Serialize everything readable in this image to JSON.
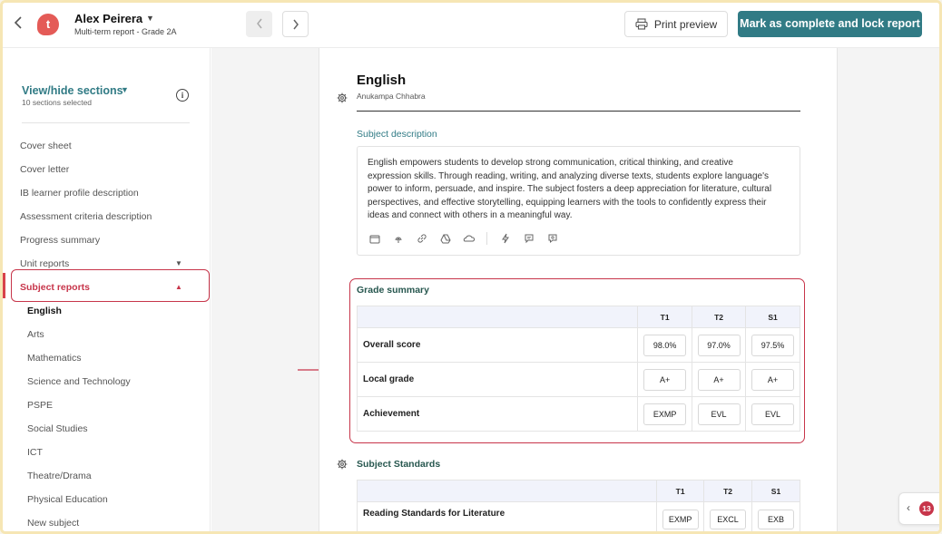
{
  "header": {
    "logo_letter": "t",
    "student_name": "Alex Peirera",
    "report_subtitle": "Multi-term report - Grade 2A",
    "print_label": "Print preview",
    "lock_label": "Mark as complete and lock report"
  },
  "sidebar": {
    "view_hide_label": "View/hide sections",
    "sections_selected": "10 sections selected",
    "items": [
      {
        "label": "Cover sheet"
      },
      {
        "label": "Cover letter"
      },
      {
        "label": "IB learner profile description"
      },
      {
        "label": "Assessment criteria description"
      },
      {
        "label": "Progress summary"
      },
      {
        "label": "Unit reports"
      }
    ],
    "active_item": "Subject reports",
    "subjects": [
      {
        "label": "English"
      },
      {
        "label": "Arts"
      },
      {
        "label": "Mathematics"
      },
      {
        "label": "Science and Technology"
      },
      {
        "label": "PSPE"
      },
      {
        "label": "Social Studies"
      },
      {
        "label": "ICT"
      },
      {
        "label": "Theatre/Drama"
      },
      {
        "label": "Physical Education"
      },
      {
        "label": "New subject"
      }
    ]
  },
  "main": {
    "subject_title": "English",
    "teacher": "Anukampa Chhabra",
    "description_heading": "Subject description",
    "description_lines": [
      "English empowers students to develop strong communication, critical thinking, and creative",
      "expression skills. Through reading, writing, and analyzing diverse texts, students explore language's",
      "power to inform, persuade, and inspire. The subject fosters a deep appreciation for literature, cultural",
      "perspectives, and effective storytelling, equipping learners with the tools to confidently express their",
      "ideas and connect with others in a meaningful way."
    ],
    "grade_summary": {
      "title": "Grade summary",
      "columns": [
        "T1",
        "T2",
        "S1"
      ],
      "rows": [
        {
          "label": "Overall score",
          "values": [
            "98.0%",
            "97.0%",
            "97.5%"
          ]
        },
        {
          "label": "Local grade",
          "values": [
            "A+",
            "A+",
            "A+"
          ]
        },
        {
          "label": "Achievement",
          "values": [
            "EXMP",
            "EVL",
            "EVL"
          ]
        }
      ]
    },
    "standards": {
      "title": "Subject Standards",
      "columns": [
        "T1",
        "T2",
        "S1"
      ],
      "rows": [
        {
          "label": "Reading Standards for Literature",
          "values": [
            "EXMP",
            "EXCL",
            "EXB"
          ]
        }
      ]
    }
  },
  "widget": {
    "badge_count": "13"
  },
  "colors": {
    "accent": "#317b85",
    "highlight": "#c7354a",
    "brand": "#e45b57"
  }
}
